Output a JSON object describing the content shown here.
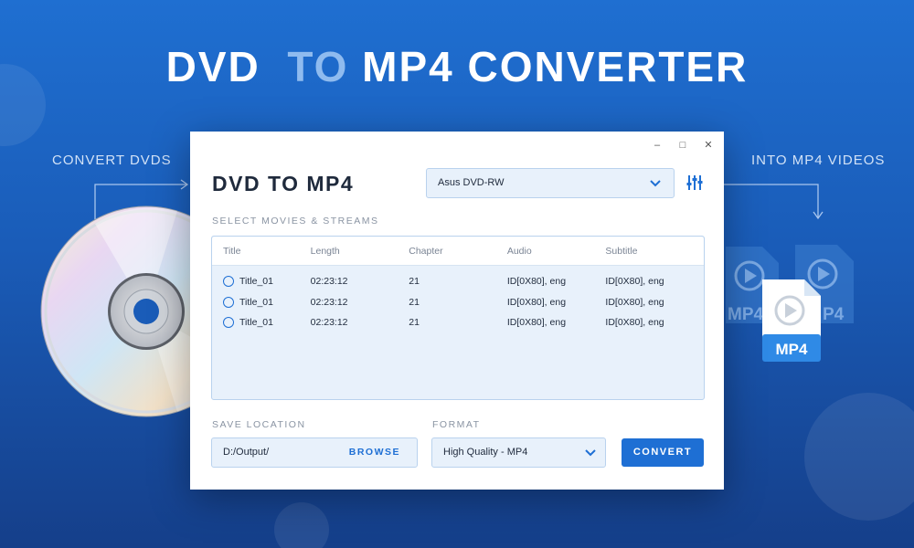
{
  "hero": {
    "title_part1": "DVD",
    "title_part2": "TO",
    "title_part3": "MP4 CONVERTER"
  },
  "side": {
    "left_label": "CONVERT DVDS",
    "right_label": "INTO MP4 VIDEOS"
  },
  "file_icons": {
    "front_label": "MP4",
    "back_label_1": "MP4",
    "back_label_2": "P4"
  },
  "window": {
    "controls": {
      "minimize": "–",
      "maximize": "□",
      "close": "✕"
    },
    "app_title": "DVD TO MP4",
    "drive_select": {
      "value": "Asus DVD-RW"
    },
    "streams_label": "SELECT MOVIES & STREAMS",
    "table": {
      "headers": [
        "Title",
        "Length",
        "Chapter",
        "Audio",
        "Subtitle"
      ],
      "rows": [
        [
          "Title_01",
          "02:23:12",
          "21",
          "ID[0X80], eng",
          "ID[0X80], eng"
        ],
        [
          "Title_01",
          "02:23:12",
          "21",
          "ID[0X80], eng",
          "ID[0X80], eng"
        ],
        [
          "Title_01",
          "02:23:12",
          "21",
          "ID[0X80], eng",
          "ID[0X80], eng"
        ]
      ]
    },
    "save_location_label": "SAVE LOCATION",
    "save_path": "D:/Output/",
    "browse_label": "BROWSE",
    "format_label": "FORMAT",
    "format_value": "High Quality - MP4",
    "convert_label": "CONVERT"
  },
  "colors": {
    "accent": "#1e6fd4",
    "background": "#1a5cb8",
    "field_bg": "#e8f1fb"
  }
}
